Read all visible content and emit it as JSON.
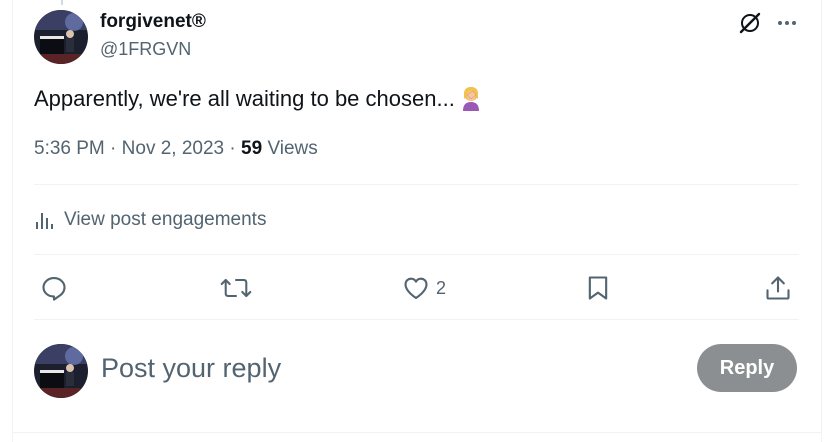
{
  "author": {
    "display_name": "forgivenet®",
    "handle": "@1FRGVN"
  },
  "post": {
    "text": "Apparently, we're all waiting to be chosen...",
    "emoji": "woman-facepalming",
    "time": "5:36 PM",
    "separator": "·",
    "date": "Nov 2, 2023",
    "views_count": "59",
    "views_label": "Views"
  },
  "engagements": {
    "label": "View post engagements"
  },
  "actions": {
    "like_count": "2"
  },
  "reply_box": {
    "placeholder": "Post your reply",
    "button_label": "Reply"
  },
  "colors": {
    "text_primary": "#0f1419",
    "text_secondary": "#536471",
    "divider": "#eff3f4",
    "reply_button_bg": "#8b8f92"
  },
  "icons": [
    "grok-icon",
    "more-icon",
    "analytics-icon",
    "reply-icon",
    "repost-icon",
    "like-icon",
    "bookmark-icon",
    "share-icon"
  ]
}
